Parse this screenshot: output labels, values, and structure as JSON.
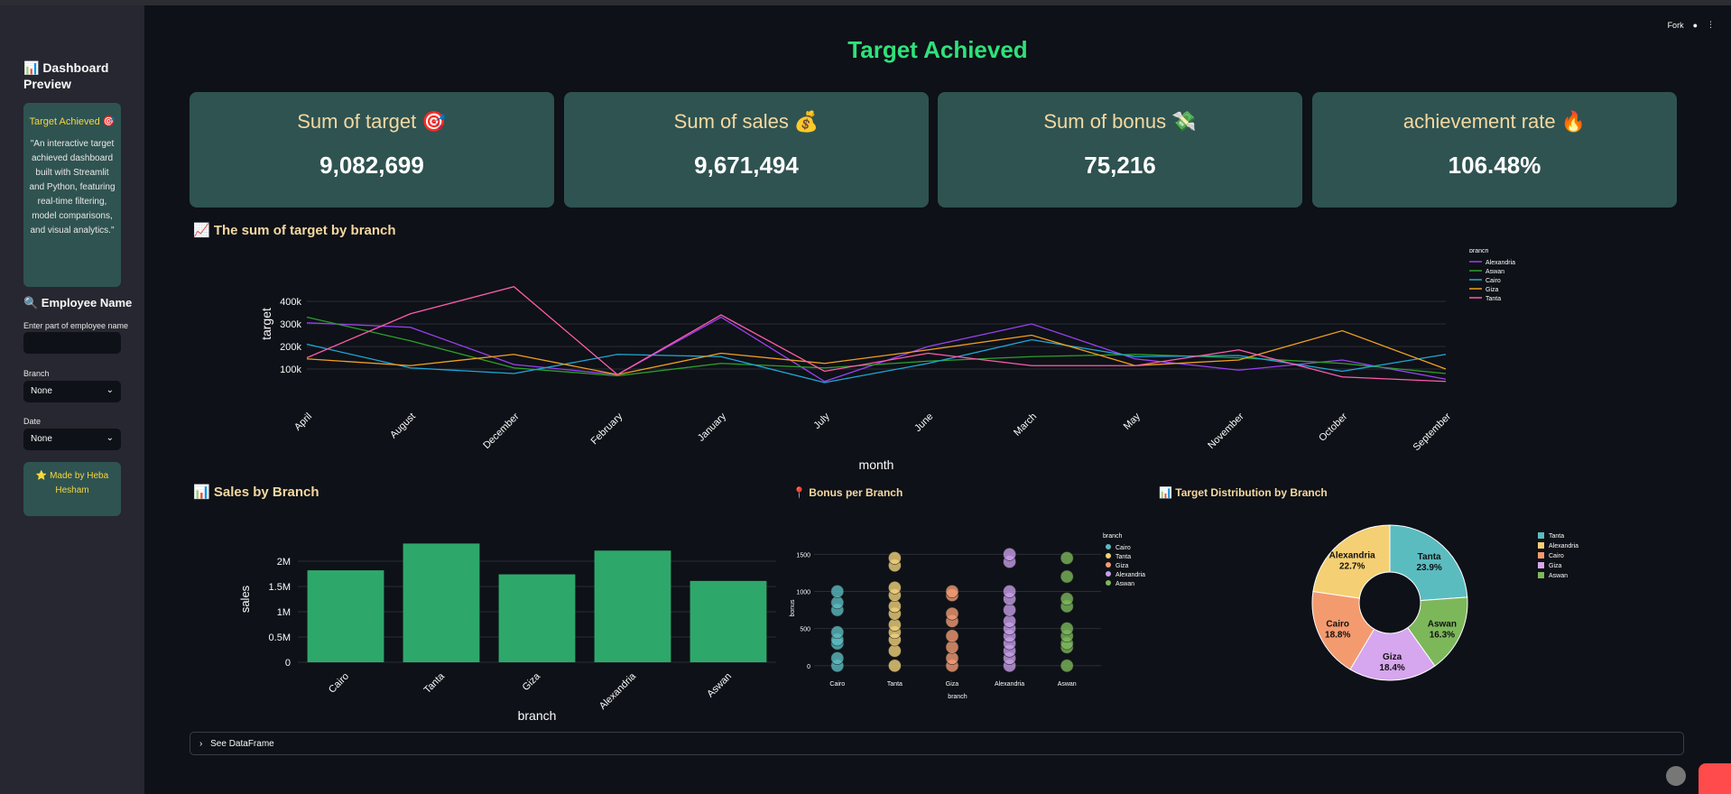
{
  "header": {
    "fork_label": "Fork"
  },
  "sidebar": {
    "title": "📊 Dashboard Preview",
    "card_title": "Target Achieved 🎯",
    "card_text": "\"An interactive target achieved dashboard built with Streamlit and Python, featuring real-time filtering, model comparisons, and visual analytics.\"",
    "employee_section": "🔍 Employee Name",
    "employee_label": "Enter part of employee name",
    "employee_value": "",
    "branch_label": "Branch",
    "branch_value": "None",
    "date_label": "Date",
    "date_value": "None",
    "made_by": "⭐ Made by Heba Hesham"
  },
  "main": {
    "title": "Target Achieved",
    "kpis": [
      {
        "label": "Sum of target 🎯",
        "value": "9,082,699"
      },
      {
        "label": "Sum of sales 💰",
        "value": "9,671,494"
      },
      {
        "label": "Sum of bonus 💸",
        "value": "75,216"
      },
      {
        "label": "achievement rate 🔥",
        "value": "106.48%"
      }
    ],
    "line_title": "📈 The sum of target by branch",
    "bar_title": "📊 Sales by Branch",
    "scatter_title": "📍 Bonus per Branch",
    "pie_title": "📊 Target Distribution by Branch",
    "expander_label": "See DataFrame"
  },
  "colors": {
    "accent": "#2ee27a",
    "card": "#2f5351",
    "section_title": "#f4d8a0",
    "Alexandria": "#9b40f2",
    "Aswan": "#2ca02c",
    "Cairo": "#1fa8d9",
    "Giza": "#f0a020",
    "Tanta": "#ff5cac"
  },
  "chart_data": [
    {
      "type": "line",
      "xlabel": "month",
      "ylabel": "target",
      "x": [
        "April",
        "August",
        "December",
        "February",
        "January",
        "July",
        "June",
        "March",
        "May",
        "November",
        "October",
        "September"
      ],
      "yticks": [
        "100k",
        "200k",
        "300k",
        "400k"
      ],
      "ylim": [
        0,
        480000
      ],
      "legend_title": "branch",
      "legend_position": "right",
      "series": [
        {
          "name": "Alexandria",
          "values": [
            305000,
            285000,
            120000,
            75000,
            330000,
            45000,
            200000,
            300000,
            145000,
            95000,
            140000,
            55000
          ]
        },
        {
          "name": "Aswan",
          "values": [
            330000,
            225000,
            105000,
            70000,
            125000,
            105000,
            135000,
            155000,
            165000,
            150000,
            125000,
            80000
          ]
        },
        {
          "name": "Cairo",
          "values": [
            210000,
            105000,
            80000,
            165000,
            155000,
            40000,
            125000,
            230000,
            155000,
            160000,
            90000,
            165000
          ]
        },
        {
          "name": "Giza",
          "values": [
            145000,
            115000,
            165000,
            75000,
            170000,
            125000,
            185000,
            250000,
            115000,
            140000,
            270000,
            100000
          ]
        },
        {
          "name": "Tanta",
          "values": [
            150000,
            345000,
            465000,
            75000,
            340000,
            90000,
            170000,
            115000,
            115000,
            185000,
            65000,
            45000
          ]
        }
      ]
    },
    {
      "type": "bar",
      "xlabel": "branch",
      "ylabel": "sales",
      "categories": [
        "Cairo",
        "Tanta",
        "Giza",
        "Alexandria",
        "Aswan"
      ],
      "values": [
        1820000,
        2350000,
        1740000,
        2210000,
        1610000
      ],
      "yticks": [
        "0",
        "0.5M",
        "1M",
        "1.5M",
        "2M"
      ],
      "ylim": [
        0,
        2500000
      ],
      "color": "#2ea86a"
    },
    {
      "type": "scatter",
      "xlabel": "branch",
      "ylabel": "bonus",
      "categories": [
        "Cairo",
        "Tanta",
        "Giza",
        "Alexandria",
        "Aswan"
      ],
      "yticks": [
        "0",
        "500",
        "1000",
        "1500"
      ],
      "ylim": [
        -100,
        1650
      ],
      "legend_title": "branch",
      "series": [
        {
          "name": "Cairo",
          "color": "#5bbcc0",
          "values": [
            0,
            100,
            300,
            350,
            450,
            750,
            850,
            1000
          ]
        },
        {
          "name": "Tanta",
          "color": "#f1d27a",
          "values": [
            0,
            200,
            350,
            450,
            550,
            700,
            800,
            950,
            1050,
            1350,
            1450
          ]
        },
        {
          "name": "Giza",
          "color": "#f29b74",
          "values": [
            0,
            100,
            250,
            400,
            600,
            700,
            950,
            1000
          ]
        },
        {
          "name": "Alexandria",
          "color": "#c79ee8",
          "values": [
            0,
            100,
            200,
            300,
            400,
            500,
            600,
            750,
            900,
            1000,
            1400,
            1500
          ]
        },
        {
          "name": "Aswan",
          "color": "#7cb85a",
          "values": [
            0,
            250,
            300,
            400,
            500,
            800,
            900,
            1200,
            1450
          ]
        }
      ]
    },
    {
      "type": "pie",
      "hole": true,
      "legend_position": "right",
      "slices": [
        {
          "name": "Tanta",
          "value": 23.9,
          "label": "23.9%",
          "color": "#5bbcc0"
        },
        {
          "name": "Aswan",
          "value": 16.3,
          "label": "16.3%",
          "color": "#7cb85a"
        },
        {
          "name": "Giza",
          "value": 18.4,
          "label": "18.4%",
          "color": "#d6a6ee"
        },
        {
          "name": "Cairo",
          "value": 18.8,
          "label": "18.8%",
          "color": "#f49a6f"
        },
        {
          "name": "Alexandria",
          "value": 22.7,
          "label": "22.7%",
          "color": "#f5cf73"
        }
      ],
      "legend_order": [
        "Tanta",
        "Alexandria",
        "Cairo",
        "Giza",
        "Aswan"
      ]
    }
  ]
}
